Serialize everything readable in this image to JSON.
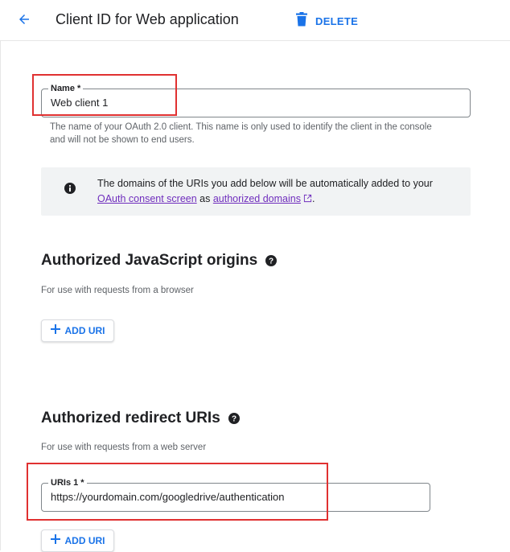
{
  "header": {
    "title": "Client ID for Web application",
    "delete_label": "DELETE"
  },
  "name_field": {
    "label": "Name *",
    "value": "Web client 1",
    "helper": "The name of your OAuth 2.0 client. This name is only used to identify the client in the console and will not be shown to end users."
  },
  "info_box": {
    "text_before": "The domains of the URIs you add below will be automatically added to your ",
    "link1": "OAuth consent screen",
    "text_middle": " as ",
    "link2": "authorized domains",
    "text_after": "."
  },
  "js_origins": {
    "heading": "Authorized JavaScript origins",
    "description": "For use with requests from a browser",
    "add_label": "ADD URI"
  },
  "redirect_uris": {
    "heading": "Authorized redirect URIs",
    "description": "For use with requests from a web server",
    "field_label": "URIs 1 *",
    "field_value": "https://yourdomain.com/googledrive/authentication",
    "add_label": "ADD URI"
  },
  "colors": {
    "accent": "#1a73e8",
    "highlight": "#e03131",
    "link_visited": "#6f2dbd"
  },
  "icons": [
    "back-arrow-icon",
    "trash-icon",
    "info-icon",
    "external-link-icon",
    "help-icon",
    "plus-icon"
  ]
}
